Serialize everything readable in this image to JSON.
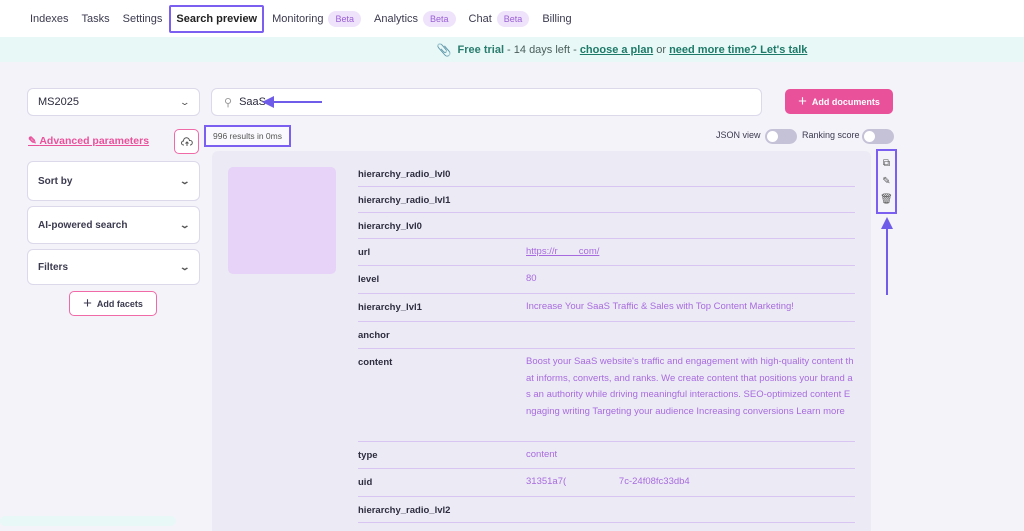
{
  "nav": {
    "items": [
      {
        "label": "Indexes"
      },
      {
        "label": "Tasks"
      },
      {
        "label": "Settings"
      },
      {
        "label": "Search preview",
        "active": true
      },
      {
        "label": "Monitoring",
        "badge": "Beta"
      },
      {
        "label": "Analytics",
        "badge": "Beta"
      },
      {
        "label": "Chat",
        "badge": "Beta"
      },
      {
        "label": "Billing"
      }
    ]
  },
  "banner": {
    "title": "Free trial",
    "days": " - 14 days left - ",
    "link1": "choose a plan",
    "or": " or ",
    "link2": "need more time? Let's talk"
  },
  "index_select": {
    "value": "MS2025"
  },
  "search": {
    "value": "SaaS"
  },
  "add_documents": "Add documents",
  "advanced_parameters": "Advanced parameters",
  "results_summary": "996 results in 0ms",
  "panels": {
    "sort": "Sort by",
    "ai": "AI-powered search",
    "filters": "Filters"
  },
  "add_facets": "Add facets",
  "toggles": {
    "json_view": "JSON view",
    "ranking_score": "Ranking score"
  },
  "document": {
    "fields": [
      {
        "key": "hierarchy_radio_lvl0",
        "value": ""
      },
      {
        "key": "hierarchy_radio_lvl1",
        "value": ""
      },
      {
        "key": "hierarchy_lvl0",
        "value": ""
      },
      {
        "key": "url",
        "value": "https://r        com/",
        "link": true
      },
      {
        "key": "level",
        "value": "80"
      },
      {
        "key": "hierarchy_lvl1",
        "value": "Increase Your SaaS Traffic & Sales with Top Content Marketing!"
      },
      {
        "key": "anchor",
        "value": ""
      },
      {
        "key": "content",
        "value": "Boost your SaaS website's traffic and engagement with high-quality content that informs, converts, and ranks. We create content that positions your brand as an authority while driving meaningful interactions. SEO-optimized content Engaging writing Targeting your audience Increasing conversions Learn more"
      },
      {
        "key": "type",
        "value": "content"
      },
      {
        "key": "uid",
        "value": "31351a7(                    7c-24f08fc33db4"
      },
      {
        "key": "hierarchy_radio_lvl2",
        "value": ""
      }
    ]
  },
  "colors": {
    "accent": "#e9519b",
    "highlight": "#7b5ff0",
    "value": "#a86bdf"
  }
}
